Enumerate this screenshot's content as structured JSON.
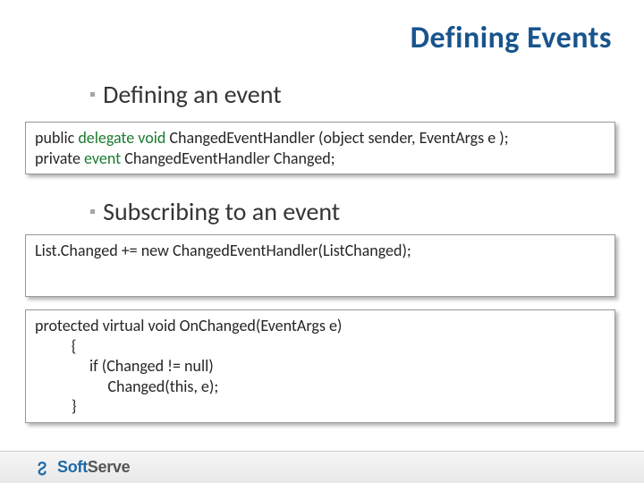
{
  "title": "Defining Events",
  "bullets": {
    "b1": "Defining an event",
    "b2": "Subscribing to an event"
  },
  "code1": {
    "l1a": "public ",
    "l1b": "delegate void",
    "l1c": " ChangedEventHandler (",
    "l1d": "object sender, EventArgs e ",
    "l1e": ");",
    "l2a": "private ",
    "l2b": "event",
    "l2c": " ChangedEventHandler Changed;"
  },
  "code2": {
    "l1": "List.Changed += new ChangedEventHandler(ListChanged);"
  },
  "code3": {
    "l1": "protected virtual void OnChanged(EventArgs e)",
    "l2": "          {",
    "l3": "               if (Changed != null)",
    "l4": "                    Changed(this, e);",
    "l5": "          }"
  },
  "footer": {
    "brand1": "Soft",
    "brand2": "Serve"
  }
}
